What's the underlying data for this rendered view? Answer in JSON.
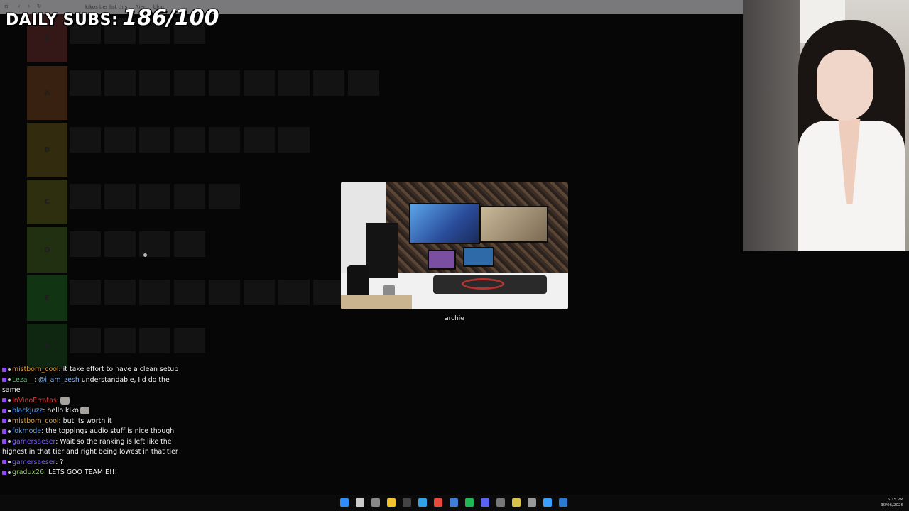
{
  "overlay": {
    "sub_counter_label": "DAILY SUBS:",
    "sub_counter_value": "186/100"
  },
  "browser": {
    "tab_text": "kikos tier list this ... /tier ... blog"
  },
  "tierlist": {
    "tiers": [
      {
        "label": "S",
        "color": "#3a1b1b",
        "thumbs": 4
      },
      {
        "label": "A",
        "color": "#3e2512",
        "thumbs": 9
      },
      {
        "label": "B",
        "color": "#38300f",
        "thumbs": 7
      },
      {
        "label": "C",
        "color": "#323410",
        "thumbs": 5
      },
      {
        "label": "D",
        "color": "#233512",
        "thumbs": 4
      },
      {
        "label": "E",
        "color": "#133a14",
        "thumbs": 8
      },
      {
        "label": "F",
        "color": "#102a13",
        "thumbs": 4
      }
    ]
  },
  "popup": {
    "caption": "archie"
  },
  "chat": {
    "messages": [
      {
        "user": "mistborn_cool",
        "color": "#e0a040",
        "text": ": it take effort to have a clean setup",
        "mention": ""
      },
      {
        "user": "Leza__",
        "color": "#4fbf6a",
        "text": " understandable, I'd do the same",
        "mention": ": @i_am_zesh"
      },
      {
        "user": "InVinoErratas",
        "color": "#e23a3a",
        "text": ":",
        "mention": "",
        "emote": true
      },
      {
        "user": "blackjuzz",
        "color": "#5aa0ff",
        "text": ": hello kiko",
        "mention": "",
        "emote": true
      },
      {
        "user": "mistborn_cool",
        "color": "#e0a040",
        "text": ": but its worth it",
        "mention": ""
      },
      {
        "user": "fokmode",
        "color": "#5aa0ff",
        "text": ": the toppings audio stuff is nice though",
        "mention": ""
      },
      {
        "user": "gamersaeser",
        "color": "#7a5cff",
        "text": ": Wait so the ranking is left like the highest in that tier and right being lowest in that tier",
        "mention": ""
      },
      {
        "user": "gamersaeser",
        "color": "#7a5cff",
        "text": ": ?",
        "mention": ""
      },
      {
        "user": "gradux26",
        "color": "#8fd14f",
        "text": ": LETS GOO TEAM E!!!",
        "mention": ""
      }
    ]
  },
  "taskbar": {
    "time": "5:15 PM",
    "date": "30/06/2026",
    "icons": [
      "windows-start",
      "search",
      "file-explorer",
      "folder",
      "obs",
      "edge",
      "chrome",
      "notes",
      "spotify",
      "discord",
      "terminal",
      "app",
      "settings",
      "browser",
      "vscode"
    ]
  }
}
